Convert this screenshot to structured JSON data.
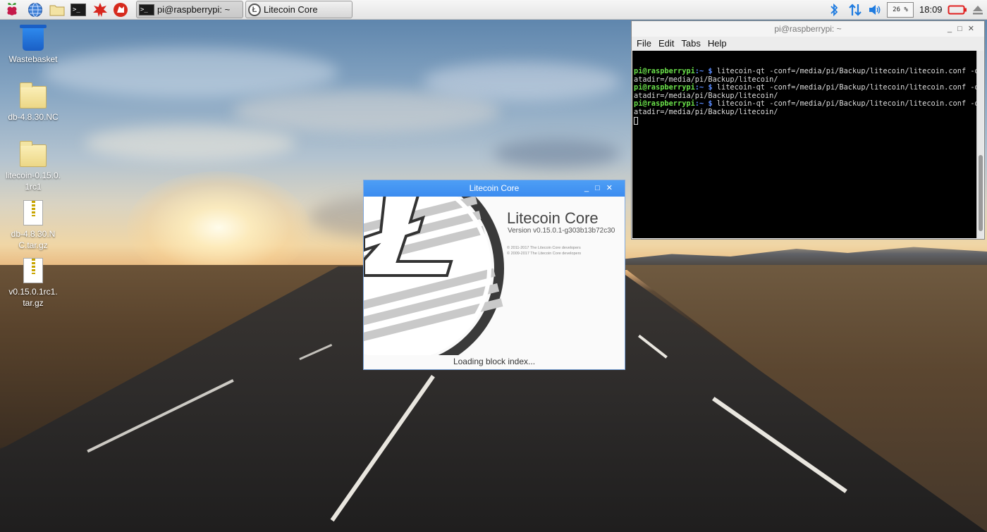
{
  "taskbar": {
    "launchers": [
      {
        "name": "raspberry-menu",
        "icon": "raspberry-icon"
      },
      {
        "name": "web-browser",
        "icon": "globe-icon"
      },
      {
        "name": "file-manager",
        "icon": "folder-icon"
      },
      {
        "name": "terminal",
        "icon": "terminal-icon"
      },
      {
        "name": "mathematica",
        "icon": "mathematica-icon"
      },
      {
        "name": "wolfram",
        "icon": "wolfram-icon"
      }
    ],
    "tasks": [
      {
        "label": "pi@raspberrypi: ~",
        "icon": "terminal-icon",
        "active": true
      },
      {
        "label": "Litecoin Core",
        "icon": "litecoin-icon",
        "active": false
      }
    ],
    "tray": {
      "bluetooth_icon": "bluetooth-icon",
      "network_icon": "network-arrows-icon",
      "volume_icon": "volume-icon",
      "cpu_label": "26 %",
      "clock": "18:09",
      "battery_icon": "battery-icon",
      "eject_icon": "eject-icon"
    }
  },
  "desktop_icons": [
    {
      "label": "Wastebasket",
      "icon": "trash-icon"
    },
    {
      "label": "db-4.8.30.NC",
      "icon": "folder-icon"
    },
    {
      "label": "litecoin-0.15.0.1rc1",
      "icon": "folder-icon"
    },
    {
      "label": "db-4.8.30.NC.tar.gz",
      "icon": "archive-icon"
    },
    {
      "label": "v0.15.0.1rc1.tar.gz",
      "icon": "archive-icon"
    }
  ],
  "terminal": {
    "title": "pi@raspberrypi: ~",
    "menu": [
      "File",
      "Edit",
      "Tabs",
      "Help"
    ],
    "prompt_user": "pi@raspberrypi",
    "prompt_path": ":~ $ ",
    "lines": [
      "litecoin-qt -conf=/media/pi/Backup/litecoin/litecoin.conf -d",
      "litecoin-qt -conf=/media/pi/Backup/litecoin/litecoin.conf -d",
      "litecoin-qt -conf=/media/pi/Backup/litecoin/litecoin.conf -d"
    ],
    "wrap": "atadir=/media/pi/Backup/litecoin/"
  },
  "splash": {
    "title": "Litecoin Core",
    "app_name": "Litecoin Core",
    "version": "Version v0.15.0.1-g303b13b72c30",
    "copyright_1": "© 2011-2017 The Litecoin Core developers",
    "copyright_2": "© 2009-2017 The Litecoin Core developers",
    "status": "Loading block index..."
  },
  "colors": {
    "splash_titlebar": "#3c8cf0",
    "prompt_user": "#6ae04a",
    "prompt_path": "#5b8cff",
    "battery": "#e02020",
    "tray_blue": "#1e7be0"
  }
}
